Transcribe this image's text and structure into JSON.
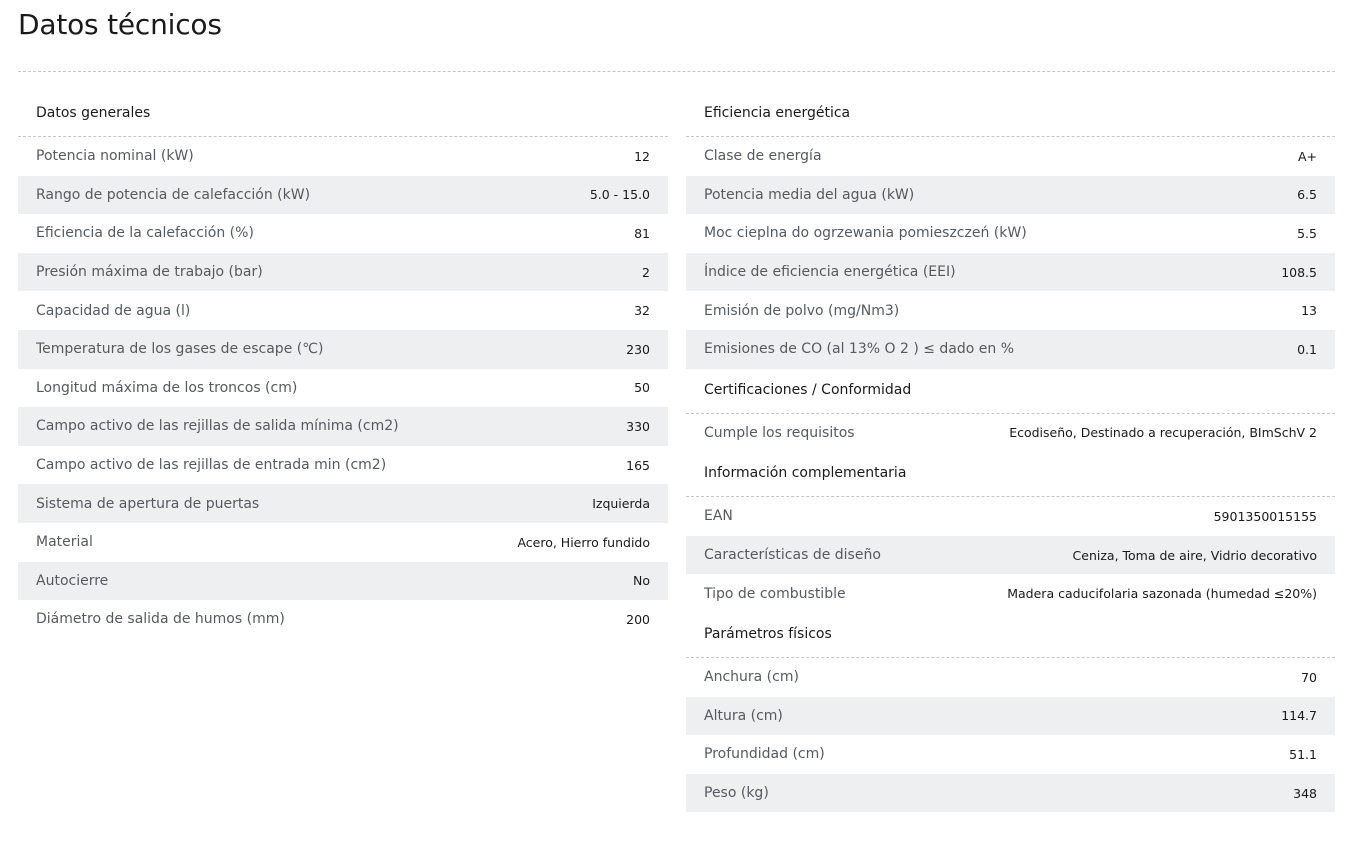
{
  "page_title": "Datos técnicos",
  "left": {
    "sections": [
      {
        "title": "Datos generales",
        "rows": [
          {
            "label": "Potencia nominal (kW)",
            "value": "12"
          },
          {
            "label": "Rango de potencia de calefacción (kW)",
            "value": "5.0 - 15.0"
          },
          {
            "label": "Eficiencia de la calefacción (%)",
            "value": "81"
          },
          {
            "label": "Presión máxima de trabajo (bar)",
            "value": "2"
          },
          {
            "label": "Capacidad de agua (l)",
            "value": "32"
          },
          {
            "label": "Temperatura de los gases de escape (℃)",
            "value": "230"
          },
          {
            "label": "Longitud máxima de los troncos (cm)",
            "value": "50"
          },
          {
            "label": "Campo activo de las rejillas de salida mínima (cm2)",
            "value": "330"
          },
          {
            "label": "Campo activo de las rejillas de entrada min (cm2)",
            "value": "165"
          },
          {
            "label": "Sistema de apertura de puertas",
            "value": "Izquierda"
          },
          {
            "label": "Material",
            "value": "Acero, Hierro fundido"
          },
          {
            "label": "Autocierre",
            "value": "No"
          },
          {
            "label": "Diámetro de salida de humos (mm)",
            "value": "200"
          }
        ]
      }
    ]
  },
  "right": {
    "sections": [
      {
        "title": "Eficiencia energética",
        "rows": [
          {
            "label": "Clase de energía",
            "value": "A+"
          },
          {
            "label": "Potencia media del agua (kW)",
            "value": "6.5"
          },
          {
            "label": "Moc cieplna do ogrzewania pomieszczeń (kW)",
            "value": "5.5"
          },
          {
            "label": "Índice de eficiencia energética (EEI)",
            "value": "108.5"
          },
          {
            "label": "Emisión de polvo (mg/Nm3)",
            "value": "13"
          },
          {
            "label": "Emisiones de CO (al 13% O 2 ) ≤ dado en %",
            "value": "0.1"
          }
        ]
      },
      {
        "title": "Certificaciones / Conformidad",
        "rows": [
          {
            "label": "Cumple los requisitos",
            "value": "Ecodiseño, Destinado a recuperación, BImSchV 2"
          }
        ]
      },
      {
        "title": "Información complementaria",
        "rows": [
          {
            "label": "EAN",
            "value": "5901350015155"
          },
          {
            "label": "Características de diseño",
            "value": "Ceniza, Toma de aire, Vidrio decorativo"
          },
          {
            "label": "Tipo de combustible",
            "value": "Madera caducifolaria sazonada (humedad ≤20%)"
          }
        ]
      },
      {
        "title": "Parámetros físicos",
        "rows": [
          {
            "label": "Anchura (cm)",
            "value": "70"
          },
          {
            "label": "Altura (cm)",
            "value": "114.7"
          },
          {
            "label": "Profundidad (cm)",
            "value": "51.1"
          },
          {
            "label": "Peso (kg)",
            "value": "348"
          }
        ]
      }
    ]
  }
}
